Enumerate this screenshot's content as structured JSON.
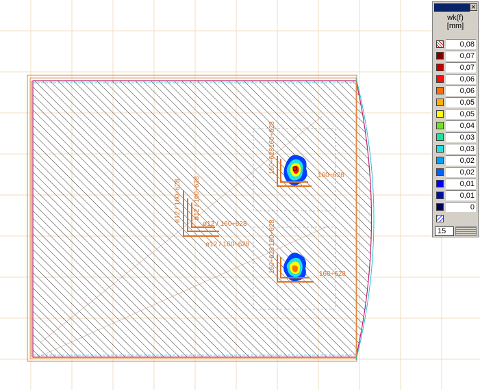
{
  "legend": {
    "title": "wk(f)",
    "unit": "[mm]",
    "rows": [
      {
        "value": "0,08",
        "color": "hatch"
      },
      {
        "value": "0,07",
        "color": "#800000"
      },
      {
        "value": "0,07",
        "color": "#c00000"
      },
      {
        "value": "0,06",
        "color": "#ff1010"
      },
      {
        "value": "0,06",
        "color": "#ff7000"
      },
      {
        "value": "0,05",
        "color": "#ffb000"
      },
      {
        "value": "0,05",
        "color": "#ffff00"
      },
      {
        "value": "0,04",
        "color": "#70e020"
      },
      {
        "value": "0,03",
        "color": "#20e0a0"
      },
      {
        "value": "0,03",
        "color": "#20e0e0"
      },
      {
        "value": "0,02",
        "color": "#00a0ff"
      },
      {
        "value": "0,02",
        "color": "#0060ff"
      },
      {
        "value": "0,01",
        "color": "#0000ff"
      },
      {
        "value": "0,01",
        "color": "#0010a0"
      },
      {
        "value": "0",
        "color": "#000060"
      },
      {
        "value": "",
        "color": "hatch-zero"
      }
    ],
    "scale_input": "15"
  },
  "labels": {
    "rebar_1": "160÷628",
    "rebar_2": "160÷628",
    "rebar_3": "160÷628",
    "rebar_4": "160÷628",
    "rebar_5": "ø12 / 160÷628",
    "rebar_6": "ø12 / 160÷628",
    "rebar_7": "ø12 / 160÷628",
    "rebar_8": "ø12 / 160÷628",
    "rebar_9": "160÷628",
    "rebar_10": "160÷628"
  },
  "colors": {
    "grid": "#f0dcc0",
    "hatch": "#303030",
    "outline_orange": "#e08030",
    "outline_magenta": "#c0206a",
    "outline_cyan": "#20c0e0",
    "rebar": "#e07020"
  }
}
